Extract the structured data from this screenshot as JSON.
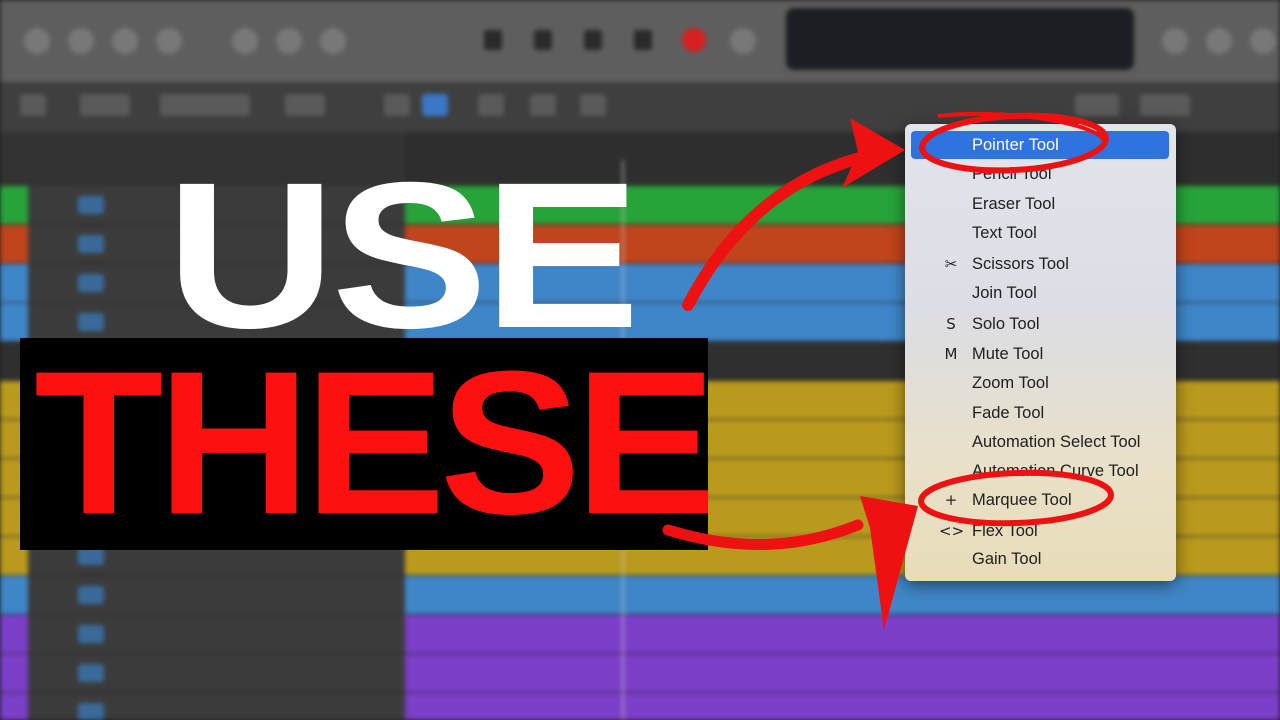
{
  "headline": {
    "line1": "USE",
    "line2": "THESE"
  },
  "tool_menu": {
    "items": [
      {
        "label": "Pointer Tool",
        "icon": "pointer-arrow-icon",
        "glyph": "",
        "selected": true
      },
      {
        "label": "Pencil Tool",
        "icon": "pencil-icon",
        "glyph": ""
      },
      {
        "label": "Eraser Tool",
        "icon": "eraser-icon",
        "glyph": ""
      },
      {
        "label": "Text Tool",
        "icon": "text-cursor-icon",
        "glyph": ""
      },
      {
        "label": "Scissors Tool",
        "icon": "scissors-icon",
        "glyph": "✂"
      },
      {
        "label": "Join Tool",
        "icon": "glue-icon",
        "glyph": ""
      },
      {
        "label": "Solo Tool",
        "icon": "solo-icon",
        "glyph": "S"
      },
      {
        "label": "Mute Tool",
        "icon": "mute-icon",
        "glyph": "M"
      },
      {
        "label": "Zoom Tool",
        "icon": "magnifier-icon",
        "glyph": ""
      },
      {
        "label": "Fade Tool",
        "icon": "fade-icon",
        "glyph": ""
      },
      {
        "label": "Automation Select Tool",
        "icon": "automation-select-icon",
        "glyph": ""
      },
      {
        "label": "Automation Curve Tool",
        "icon": "automation-curve-icon",
        "glyph": ""
      },
      {
        "label": "Marquee Tool",
        "icon": "crosshair-icon",
        "glyph": "+"
      },
      {
        "label": "Flex Tool",
        "icon": "flex-icon",
        "glyph": "<>"
      },
      {
        "label": "Gain Tool",
        "icon": "gain-icon",
        "glyph": ""
      }
    ]
  },
  "colors": {
    "accent_red": "#ff1010",
    "selection_blue": "#2f73e0"
  }
}
